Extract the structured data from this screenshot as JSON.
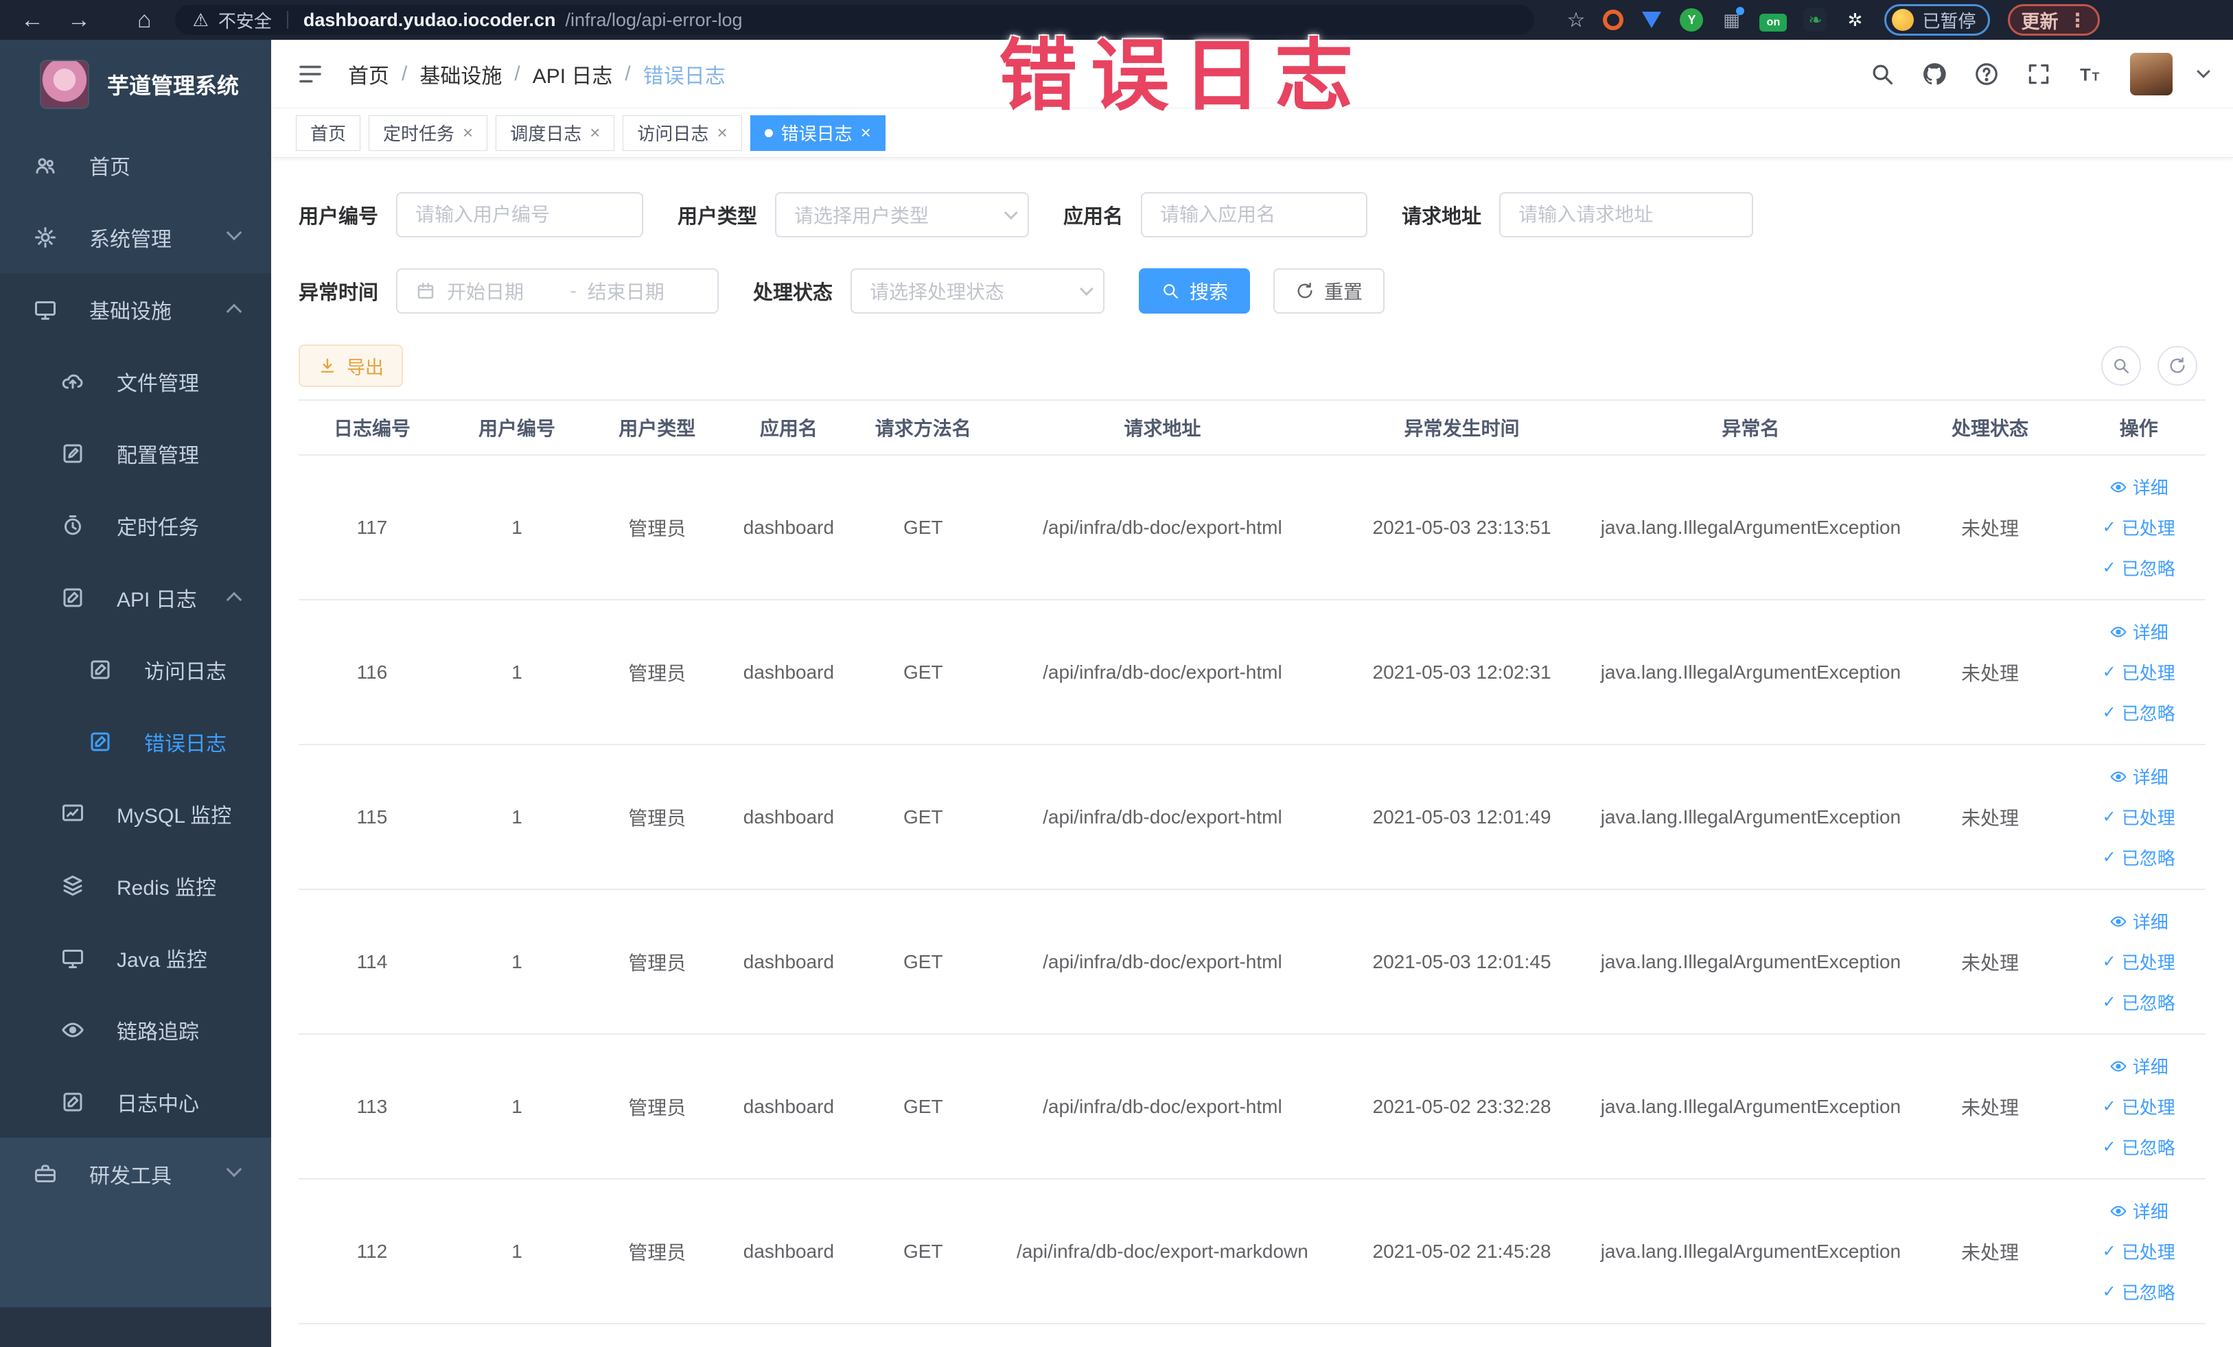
{
  "browser": {
    "security_label": "不安全",
    "url_domain": "dashboard.yudao.iocoder.cn",
    "url_path": "/infra/log/api-error-log",
    "paused_label": "已暂停",
    "update_label": "更新",
    "extensions": [
      {
        "id": "orange",
        "label": ""
      },
      {
        "id": "blue",
        "label": ""
      },
      {
        "id": "green",
        "label": "Y"
      },
      {
        "id": "grid",
        "label": "▦"
      },
      {
        "id": "badge",
        "label": "on"
      },
      {
        "id": "leaf",
        "label": "❧"
      },
      {
        "id": "paw",
        "label": "✲"
      }
    ]
  },
  "watermark": "错误日志",
  "sidebar": {
    "title": "芋道管理系统",
    "items": [
      {
        "label": "首页",
        "icon": "users",
        "depth": 0,
        "tone": "base"
      },
      {
        "label": "系统管理",
        "icon": "gear",
        "depth": 0,
        "tone": "base",
        "chevron": "down"
      },
      {
        "label": "基础设施",
        "icon": "monitor",
        "depth": 0,
        "tone": "dark",
        "chevron": "up"
      },
      {
        "label": "文件管理",
        "icon": "cloud",
        "depth": 1,
        "tone": "dark"
      },
      {
        "label": "配置管理",
        "icon": "edit",
        "depth": 1,
        "tone": "dark"
      },
      {
        "label": "定时任务",
        "icon": "timer",
        "depth": 1,
        "tone": "dark"
      },
      {
        "label": "API 日志",
        "icon": "logdoc",
        "depth": 1,
        "tone": "dark",
        "chevron": "up"
      },
      {
        "label": "访问日志",
        "icon": "logdoc",
        "depth": 2,
        "tone": "dark"
      },
      {
        "label": "错误日志",
        "icon": "logdoc",
        "depth": 2,
        "tone": "dark",
        "active": true
      },
      {
        "label": "MySQL 监控",
        "icon": "chart",
        "depth": 1,
        "tone": "dark"
      },
      {
        "label": "Redis 监控",
        "icon": "layers",
        "depth": 1,
        "tone": "dark"
      },
      {
        "label": "Java 监控",
        "icon": "monitor",
        "depth": 1,
        "tone": "dark"
      },
      {
        "label": "链路追踪",
        "icon": "eye",
        "depth": 1,
        "tone": "dark"
      },
      {
        "label": "日志中心",
        "icon": "logdoc",
        "depth": 1,
        "tone": "dark"
      },
      {
        "label": "研发工具",
        "icon": "briefcase",
        "depth": 0,
        "tone": "light",
        "chevron": "down"
      }
    ]
  },
  "breadcrumb": [
    "首页",
    "基础设施",
    "API 日志",
    "错误日志"
  ],
  "tabs": {
    "items": [
      {
        "label": "首页",
        "closable": false,
        "active": false
      },
      {
        "label": "定时任务",
        "closable": true,
        "active": false
      },
      {
        "label": "调度日志",
        "closable": true,
        "active": false
      },
      {
        "label": "访问日志",
        "closable": true,
        "active": false
      },
      {
        "label": "错误日志",
        "closable": true,
        "active": true
      }
    ]
  },
  "filters": {
    "user_id_label": "用户编号",
    "user_id_placeholder": "请输入用户编号",
    "user_type_label": "用户类型",
    "user_type_placeholder": "请选择用户类型",
    "app_name_label": "应用名",
    "app_name_placeholder": "请输入应用名",
    "request_url_label": "请求地址",
    "request_url_placeholder": "请输入请求地址",
    "exception_time_label": "异常时间",
    "date_start_placeholder": "开始日期",
    "date_separator": "-",
    "date_end_placeholder": "结束日期",
    "process_status_label": "处理状态",
    "process_status_placeholder": "请选择处理状态",
    "search_label": "搜索",
    "reset_label": "重置"
  },
  "toolbar": {
    "export_label": "导出"
  },
  "table": {
    "headers": [
      "日志编号",
      "用户编号",
      "用户类型",
      "应用名",
      "请求方法名",
      "请求地址",
      "异常发生时间",
      "异常名",
      "处理状态",
      "操作"
    ],
    "action_labels": {
      "detail": "详细",
      "processed": "已处理",
      "ignored": "已忽略"
    },
    "rows": [
      {
        "id": "117",
        "user_id": "1",
        "user_type": "管理员",
        "app": "dashboard",
        "method": "GET",
        "url": "/api/infra/db-doc/export-html",
        "time": "2021-05-03 23:13:51",
        "exception": "java.lang.IllegalArgumentException",
        "status": "未处理"
      },
      {
        "id": "116",
        "user_id": "1",
        "user_type": "管理员",
        "app": "dashboard",
        "method": "GET",
        "url": "/api/infra/db-doc/export-html",
        "time": "2021-05-03 12:02:31",
        "exception": "java.lang.IllegalArgumentException",
        "status": "未处理"
      },
      {
        "id": "115",
        "user_id": "1",
        "user_type": "管理员",
        "app": "dashboard",
        "method": "GET",
        "url": "/api/infra/db-doc/export-html",
        "time": "2021-05-03 12:01:49",
        "exception": "java.lang.IllegalArgumentException",
        "status": "未处理"
      },
      {
        "id": "114",
        "user_id": "1",
        "user_type": "管理员",
        "app": "dashboard",
        "method": "GET",
        "url": "/api/infra/db-doc/export-html",
        "time": "2021-05-03 12:01:45",
        "exception": "java.lang.IllegalArgumentException",
        "status": "未处理"
      },
      {
        "id": "113",
        "user_id": "1",
        "user_type": "管理员",
        "app": "dashboard",
        "method": "GET",
        "url": "/api/infra/db-doc/export-html",
        "time": "2021-05-02 23:32:28",
        "exception": "java.lang.IllegalArgumentException",
        "status": "未处理"
      },
      {
        "id": "112",
        "user_id": "1",
        "user_type": "管理员",
        "app": "dashboard",
        "method": "GET",
        "url": "/api/infra/db-doc/export-markdown",
        "time": "2021-05-02 21:45:28",
        "exception": "java.lang.IllegalArgumentException",
        "status": "未处理"
      }
    ]
  },
  "colors": {
    "accent": "#409eff",
    "warning_text": "#e6a23c",
    "watermark": "#e84360",
    "sidebar_bg": "#2e4054",
    "browser_bar_bg": "#1c2333"
  }
}
